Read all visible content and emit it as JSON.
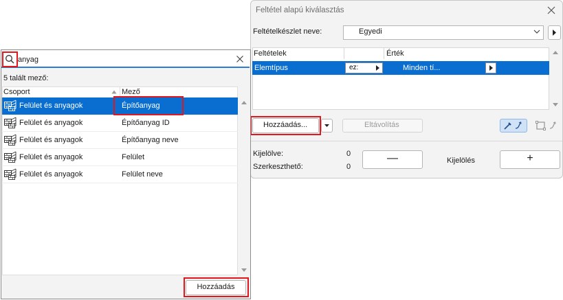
{
  "dialog": {
    "title": "Feltétel alapú kiválasztás",
    "criteria_set_label": "Feltételkészlet neve:",
    "criteria_set_value": "Egyedi",
    "table": {
      "col_criteria": "Feltételek",
      "col_value": "Érték",
      "rows": [
        {
          "criterion": "Elemtípus",
          "operator": "ez:",
          "value": "Minden tí..."
        }
      ]
    },
    "add_button": "Hozzáadás...",
    "remove_button": "Eltávolítás",
    "selected_label": "Kijelölve:",
    "selected_count": "0",
    "editable_label": "Szerkeszthető:",
    "editable_count": "0",
    "minus_label": "—",
    "selection_label": "Kijelölés",
    "plus_label": "+",
    "accent_color": "#0a6ed1",
    "highlight_color": "#e3161b"
  },
  "search_panel": {
    "search_value": "anyag",
    "found_label": "5 talált mező:",
    "col_group": "Csoport",
    "col_field": "Mező",
    "rows": [
      {
        "group": "Felület és anyagok",
        "field": "Építőanyag",
        "selected": true
      },
      {
        "group": "Felület és anyagok",
        "field": "Építőanyag ID",
        "selected": false
      },
      {
        "group": "Felület és anyagok",
        "field": "Építőanyag neve",
        "selected": false
      },
      {
        "group": "Felület és anyagok",
        "field": "Felület",
        "selected": false
      },
      {
        "group": "Felület és anyagok",
        "field": "Felület neve",
        "selected": false
      }
    ],
    "add_button": "Hozzáadás",
    "icons": [
      "search-icon",
      "clear-icon",
      "surface-material-icon",
      "sort-icon"
    ]
  }
}
